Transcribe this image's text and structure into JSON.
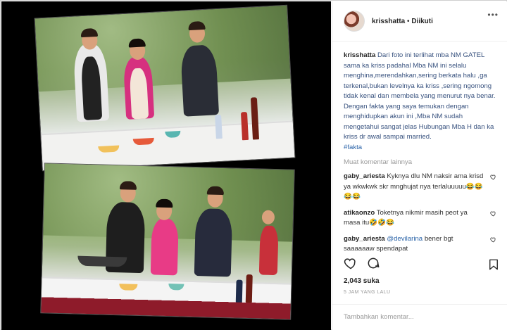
{
  "header": {
    "username": "krisshatta",
    "separator": "•",
    "follow_label": "Diikuti"
  },
  "caption": {
    "username": "krisshatta",
    "text": "Dari foto ini terlihat mba NM GATEL sama ka kriss padahal Mba NM ini selalu menghina,merendahkan,sering berkata halu ,ga terkenal,bukan levelnya ka kriss ,sering ngomong tidak kenal dan membela yang menurut nya benar. Dengan fakta yang saya temukan dengan menghidupkan akun ini ,Mba NM sudah mengetahui sangat jelas Hubungan Mba H dan ka kriss dr awal sampai married.",
    "hashtag": "#fakta"
  },
  "more_comments_label": "Muat komentar lainnya",
  "comments": [
    {
      "username": "gaby_ariesta",
      "text": "Kyknya dlu NM naksir ama krisd ya wkwkwk skr mnghujat nya terlaluuuuu😂😂😂😂"
    },
    {
      "username": "atikaonzo",
      "text": "Toketnya nikmir masih peot ya masa itu🤣🤣😂"
    },
    {
      "username": "gaby_ariesta",
      "mention": "@devilarina",
      "text": "bener bgt saaaaaaw spendapat"
    }
  ],
  "likes_label": "2,043 suka",
  "time_label": "5 JAM YANG LALU",
  "add_comment_placeholder": "Tambahkan komentar...",
  "more_options_label": "•••",
  "icons": {
    "heart": "heart-icon",
    "comment": "comment-icon",
    "bookmark": "bookmark-icon"
  }
}
